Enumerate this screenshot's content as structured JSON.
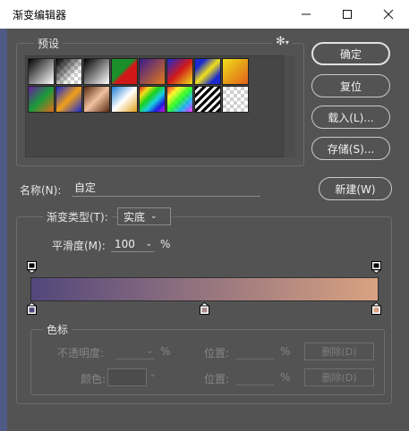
{
  "window": {
    "title": "渐变编辑器",
    "minimize_icon": "minimize-icon",
    "maximize_icon": "maximize-icon",
    "close_icon": "close-icon"
  },
  "presets": {
    "label": "预设",
    "menu_icon": "gear-icon",
    "swatch_count": 16
  },
  "buttons": {
    "ok": "确定",
    "reset": "复位",
    "load": "载入(L)...",
    "save": "存储(S)...",
    "new": "新建(W)"
  },
  "name": {
    "label": "名称(N):",
    "value": "自定"
  },
  "gradient": {
    "type_label": "渐变类型(T):",
    "type_value": "实底",
    "smoothness_label": "平滑度(M):",
    "smoothness_value": "100",
    "smoothness_unit": "%",
    "start_color": "#52477c",
    "end_color": "#d9a281"
  },
  "stops": {
    "group_label": "色标",
    "opacity_label": "不透明度:",
    "opacity_unit": "%",
    "location_label_1": "位置:",
    "location_unit_1": "%",
    "delete_label_1": "删除(D)",
    "color_label": "颜色:",
    "location_label_2": "位置:",
    "location_unit_2": "%",
    "delete_label_2": "删除(D)"
  }
}
